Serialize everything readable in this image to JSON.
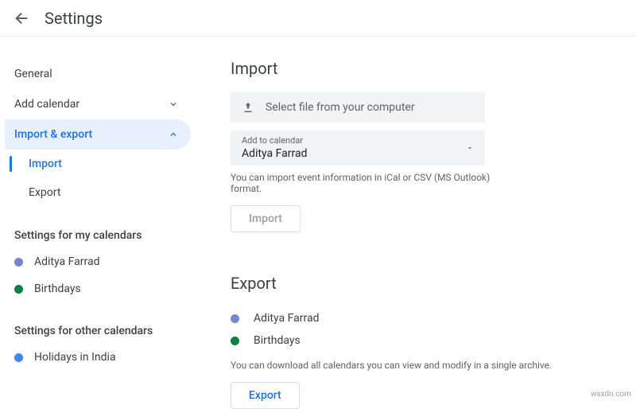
{
  "header": {
    "title": "Settings"
  },
  "sidebar": {
    "general": "General",
    "add_calendar": "Add calendar",
    "import_export": "Import & export",
    "sub_import": "Import",
    "sub_export": "Export",
    "section_my": "Settings for my calendars",
    "my_calendars": [
      {
        "label": "Aditya Farrad",
        "color": "#7986cb"
      },
      {
        "label": "Birthdays",
        "color": "#0b8043"
      }
    ],
    "section_other": "Settings for other calendars",
    "other_calendars": [
      {
        "label": "Holidays in India",
        "color": "#4285f4"
      }
    ]
  },
  "import": {
    "title": "Import",
    "file_select": "Select file from your computer",
    "add_to_label": "Add to calendar",
    "add_to_value": "Aditya Farrad",
    "helper": "You can import event information in iCal or CSV (MS Outlook) format.",
    "button": "Import"
  },
  "export": {
    "title": "Export",
    "items": [
      {
        "label": "Aditya Farrad",
        "color": "#7986cb"
      },
      {
        "label": "Birthdays",
        "color": "#0b8043"
      }
    ],
    "helper": "You can download all calendars you can view and modify in a single archive.",
    "button": "Export"
  },
  "watermark": "wsxdn.com"
}
